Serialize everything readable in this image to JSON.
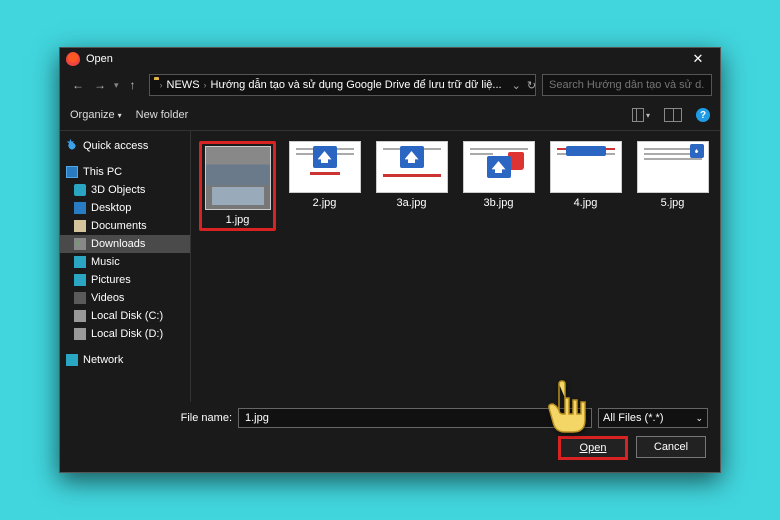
{
  "title": "Open",
  "nav": {
    "back": "←",
    "forward": "→",
    "up": "↑"
  },
  "breadcrumb": {
    "parent": "NEWS",
    "current": "Hướng dẫn tạo và sử dụng Google Drive để lưu trữ dữ liệ..."
  },
  "search_placeholder": "Search Hướng dẫn tạo và sử d...",
  "toolbar": {
    "organize": "Organize",
    "new_folder": "New folder"
  },
  "sidebar": {
    "quick": "Quick access",
    "this_pc": "This PC",
    "items": [
      "3D Objects",
      "Desktop",
      "Documents",
      "Downloads",
      "Music",
      "Pictures",
      "Videos",
      "Local Disk (C:)",
      "Local Disk (D:)"
    ],
    "network": "Network"
  },
  "files": [
    "1.jpg",
    "2.jpg",
    "3a.jpg",
    "3b.jpg",
    "4.jpg",
    "5.jpg"
  ],
  "filename_label": "File name:",
  "filename_value": "1.jpg",
  "file_type": "All Files (*.*)",
  "buttons": {
    "open": "Open",
    "cancel": "Cancel"
  }
}
